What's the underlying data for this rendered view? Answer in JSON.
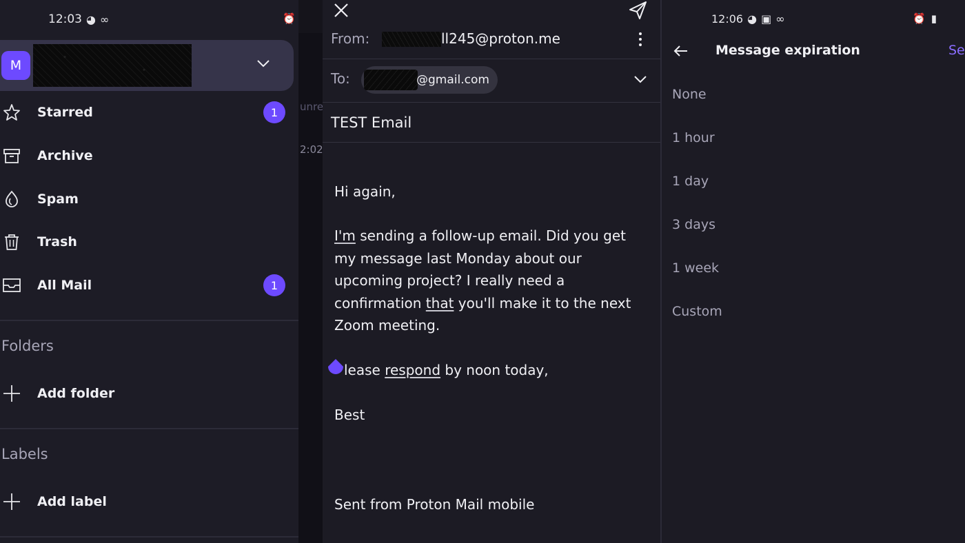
{
  "drawer": {
    "statusbar": {
      "time": "12:03"
    },
    "account": {
      "avatar_initial": "M"
    },
    "nav_items": [
      {
        "label": "Starred",
        "badge": "1",
        "icon": "star-icon"
      },
      {
        "label": "Archive",
        "badge": "",
        "icon": "archive-icon"
      },
      {
        "label": "Spam",
        "badge": "",
        "icon": "spam-icon"
      },
      {
        "label": "Trash",
        "badge": "",
        "icon": "trash-icon"
      },
      {
        "label": "All Mail",
        "badge": "1",
        "icon": "all-mail-icon"
      }
    ],
    "folders": {
      "title": "Folders",
      "add_label": "Add folder"
    },
    "labels": {
      "title": "Labels",
      "add_label": "Add label"
    },
    "peek": {
      "text1": "unre",
      "text2": "2:02"
    }
  },
  "compose": {
    "from_label": "From:",
    "from_value": "ll245@proton.me",
    "to_label": "To:",
    "to_value": "@gmail.com",
    "subject": "TEST Email",
    "body": {
      "greeting": "Hi again,",
      "p1_underlined_start": "I'm",
      "p1_rest_a": " sending a follow-up email. Did you get my message last Monday about our upcoming project? I really need a confirmation ",
      "p1_underlined_that": "that",
      "p1_rest_b": " you'll make it to the next Zoom meeting.",
      "p2_start": "lease ",
      "p2_underlined": "respond",
      "p2_rest": " by noon today,",
      "closing": "Best",
      "signature": "Sent from Proton Mail mobile"
    }
  },
  "expiration": {
    "statusbar": {
      "time": "12:06"
    },
    "title": "Message expiration",
    "set_label": "Set",
    "options": [
      "None",
      "1 hour",
      "1 day",
      "3 days",
      "1 week",
      "Custom"
    ]
  },
  "colors": {
    "accent": "#6d4aff",
    "background": "#1c1b24",
    "account_box": "#36344a"
  }
}
